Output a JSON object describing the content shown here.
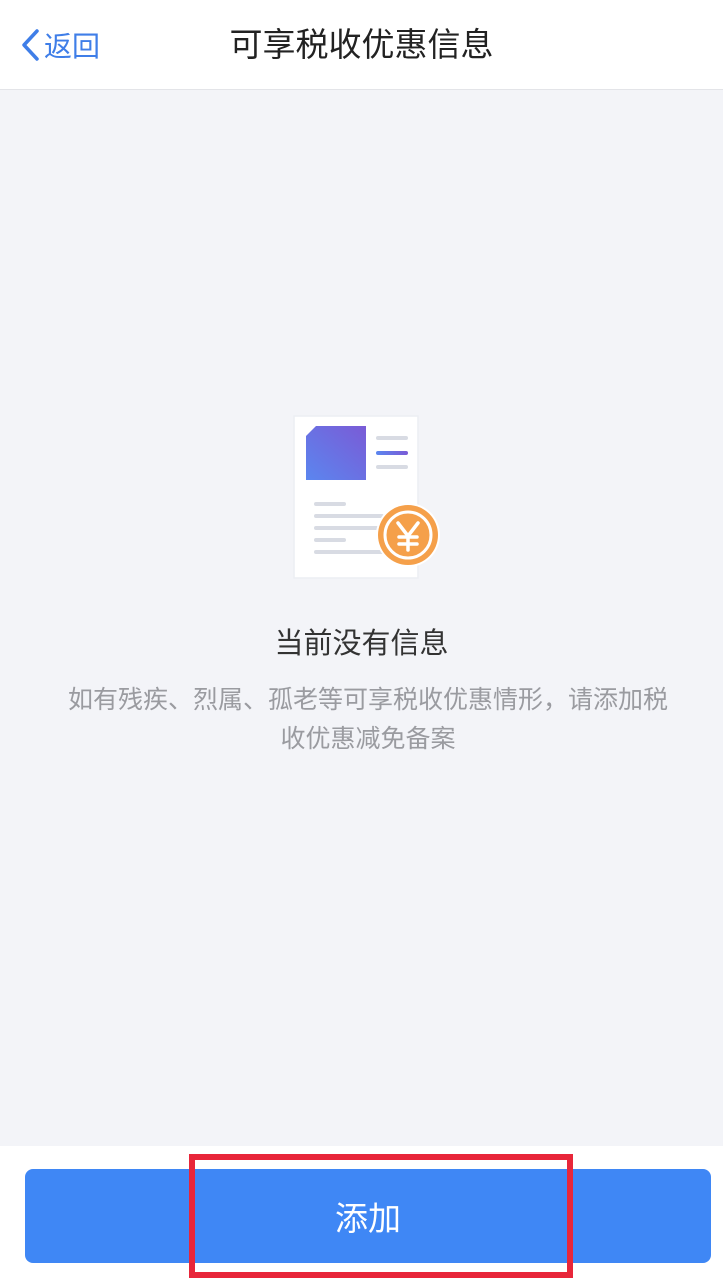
{
  "nav": {
    "back_label": "返回",
    "title": "可享税收优惠信息"
  },
  "empty_state": {
    "icon": "document-yuan-icon",
    "title": "当前没有信息",
    "description": "如有残疾、烈属、孤老等可享税收优惠情形，请添加税收优惠减免备案"
  },
  "footer": {
    "add_label": "添加"
  },
  "colors": {
    "accent": "#3f87f5",
    "back_link": "#3f7ee8",
    "highlight": "#e8263a",
    "background": "#f3f4f8",
    "coin": "#f5a04a"
  }
}
